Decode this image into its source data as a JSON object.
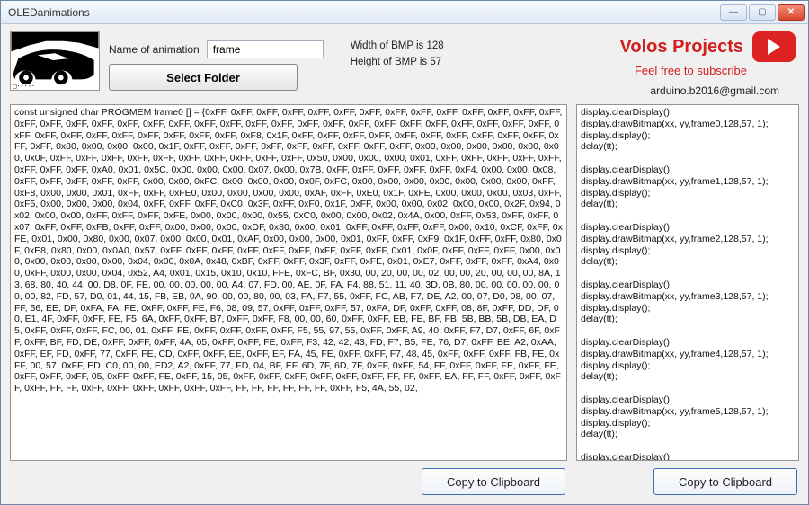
{
  "window": {
    "title": "OLEDanimations"
  },
  "controls": {
    "name_label": "Name of animation",
    "name_value": "frame",
    "select_folder": "Select Folder"
  },
  "bmp": {
    "width_label": "Width of BMP is 128",
    "height_label": "Height of BMP is 57"
  },
  "brand": {
    "title": "Volos Projects",
    "subtitle": "Feel free to subscribe",
    "email": "arduino.b2016@gmail.com"
  },
  "hex_output": "const unsigned char PROGMEM frame0 [] = {0xFF, 0xFF, 0xFF, 0xFF, 0xFF, 0xFF, 0xFF, 0xFF, 0xFF, 0xFF, 0xFF, 0xFF, 0xFF, 0xFF, 0xFF, 0xFF, 0xFF, 0xFF, 0xFF, 0xFF, 0xFF, 0xFF, 0xFF, 0xFF, 0xFF, 0xFF, 0xFF, 0xFF, 0xFF, 0xFF, 0xFF, 0xFF, 0xFF, 0xFF, 0xFF, 0xFF, 0xFF, 0xFF, 0xFF, 0xFF, 0xFF, 0xFF, 0xFF, 0xFF, 0xF8, 0x1F, 0xFF, 0xFF, 0xFF, 0xFF, 0xFF, 0xFF, 0xFF, 0xFF, 0xFF, 0xFF, 0xFF, 0xFF, 0x80, 0x00, 0x00, 0x00, 0x1F, 0xFF, 0xFF, 0xFF, 0xFF, 0xFF, 0xFF, 0xFF, 0xFF, 0xFF, 0x00, 0x00, 0x00, 0x00, 0x00, 0x00, 0x0F, 0xFF, 0xFF, 0xFF, 0xFF, 0xFF, 0xFF, 0xFF, 0xFF, 0xFF, 0xFF, 0x50, 0x00, 0x00, 0x00, 0x01, 0xFF, 0xFF, 0xFF, 0xFF, 0xFF, 0xFF, 0xFF, 0xFF, 0xA0, 0x01, 0x5C, 0x00, 0x00, 0x00, 0x07, 0x00, 0x7B, 0xFF, 0xFF, 0xFF, 0xFF, 0xFF, 0xF4, 0x00, 0x00, 0x08, 0xFF, 0xFF, 0xFF, 0xFF, 0xFF, 0x00, 0x00, 0xFC, 0x00, 0x00, 0x00, 0x0F, 0xFC, 0x00, 0x00, 0x00, 0x00, 0x00, 0x00, 0x00, 0xFF, 0xF8, 0x00, 0x00, 0x01, 0xFF, 0xFF, 0xFE0, 0x00, 0x00, 0x00, 0x00, 0xAF, 0xFF, 0xE0, 0x1F, 0xFE, 0x00, 0x00, 0x00, 0x03, 0xFF, 0xF5, 0x00, 0x00, 0x00, 0x04, 0xFF, 0xFF, 0xFF, 0xC0, 0x3F, 0xFF, 0xF0, 0x1F, 0xFF, 0x00, 0x00, 0x02, 0x00, 0x00, 0x2F, 0x94, 0x02, 0x00, 0x00, 0xFF, 0xFF, 0xFF, 0xFE, 0x00, 0x00, 0x00, 0x55, 0xC0, 0x00, 0x00, 0x02, 0x4A, 0x00, 0xFF, 0x53, 0xFF, 0xFF, 0x07, 0xFF, 0xFF, 0xFB, 0xFF, 0xFF, 0x00, 0x00, 0x00, 0xDF, 0x80, 0x00, 0x01, 0xFF, 0xFF, 0xFF, 0xFF, 0x00, 0x10, 0xCF, 0xFF, 0xFE, 0x01, 0x00, 0x80, 0x00, 0x07, 0x00, 0x00, 0x01, 0xAF, 0x00, 0x00, 0x00, 0x01, 0xFF, 0xFF, 0xF9, 0x1F, 0xFF, 0xFF, 0x80, 0x0F, 0xE8, 0x80, 0x00, 0x0A0, 0x57, 0xFF, 0xFF, 0xFF, 0xFF, 0xFF, 0xFF, 0xFF, 0xFF, 0xFF, 0x01, 0x0F, 0xFF, 0xFF, 0xFF, 0x00, 0x00, 0x00, 0x00, 0x00, 0x00, 0x04, 0x00, 0x0A, 0x48, 0xBF, 0xFF, 0xFF, 0x3F, 0xFF, 0xFE, 0x01, 0xE7, 0xFF, 0xFF, 0xFF, 0xA4, 0x00, 0xFF, 0x00, 0x00, 0x04, 0x52, A4, 0x01, 0x15, 0x10, 0x10, FFE, 0xFC, BF, 0x30, 00, 20, 00, 00, 02, 00, 00, 20, 00, 00, 00, 8A, 13, 68, 80, 40, 44, 00, D8, 0F, FE, 00, 00, 00, 00, 00, A4, 07, FD, 00, AE, 0F, FA, F4, 88, 51, 11, 40, 3D, 0B, 80, 00, 00, 00, 00, 00, 00, 00, 82, FD, 57, D0, 01, 44, 15, FB, EB, 0A, 90, 00, 00, 80, 00, 03, FA, F7, 55, 0xFF, FC, AB, F7, DE, A2, 00, 07, D0, 08, 00, 07, FF, 56, EE, DF, 0xFA, FA, FE, 0xFF, 0xFF, FE, F6, 08, 09, 57, 0xFF, 0xFF, 0xFF, 57, 0xFA, DF, 0xFF, 0xFF, 08, 8F, 0xFF, DD, DF, 00, E1, 4F, 0xFF, 0xFF, FE, F5, 6A, 0xFF, 0xFF, B7, 0xFF, 0xFF, F8, 00, 00, 60, 0xFF, 0xFF, EB, FE, BF, FB, 5B, BB, 5B, DB, EA, D5, 0xFF, 0xFF, 0xFF, FC, 00, 01, 0xFF, FE, 0xFF, 0xFF, 0xFF, 0xFF, F5, 55, 97, 55, 0xFF, 0xFF, A9, 40, 0xFF, F7, D7, 0xFF, 6F, 0xFF, 0xFF, BF, FD, DE, 0xFF, 0xFF, 0xFF, 4A, 05, 0xFF, 0xFF, FE, 0xFF, F3, 42, 42, 43, FD, F7, B5, FE, 76, D7, 0xFF, BE, A2, 0xAA, 0xFF, EF, FD, 0xFF, 77, 0xFF, FE, CD, 0xFF, 0xFF, EE, 0xFF, EF, FA, 45, FE, 0xFF, 0xFF, F7, 48, 45, 0xFF, 0xFF, 0xFF, FB, FE, 0xFF, 00, 57, 0xFF, ED, C0, 00, 00, ED2, A2, 0xFF, 77, FD, 04, BF, EF, 6D, 7F, 6D, 7F, 0xFF, 0xFF, 54, FF, 0xFF, 0xFF, FE, 0xFF, FE, 0xFF, 0xFF, 0xFF, 05, 0xFF, 0xFF, FE, 0xFF, 15, 05, 0xFF, 0xFF, 0xFF, 0xFF, 0xFF, 0xFF, FF, FF, 0xFF, EA, FF, FF, 0xFF, 0xFF, 0xFF, 0xFF, FF, FF, 0xFF, 0xFF, 0xFF, 0xFF, 0xFF, 0xFF, FF, FF, FF, FF, FF, FF, 0xFF, F5, 4A, 55, 02,",
  "code_output": "display.clearDisplay();\ndisplay.drawBitmap(xx, yy,frame0,128,57, 1);\ndisplay.display();\ndelay(tt);\n\ndisplay.clearDisplay();\ndisplay.drawBitmap(xx, yy,frame1,128,57, 1);\ndisplay.display();\ndelay(tt);\n\ndisplay.clearDisplay();\ndisplay.drawBitmap(xx, yy,frame2,128,57, 1);\ndisplay.display();\ndelay(tt);\n\ndisplay.clearDisplay();\ndisplay.drawBitmap(xx, yy,frame3,128,57, 1);\ndisplay.display();\ndelay(tt);\n\ndisplay.clearDisplay();\ndisplay.drawBitmap(xx, yy,frame4,128,57, 1);\ndisplay.display();\ndelay(tt);\n\ndisplay.clearDisplay();\ndisplay.drawBitmap(xx, yy,frame5,128,57, 1);\ndisplay.display();\ndelay(tt);\n\ndisplay.clearDisplay();",
  "buttons": {
    "copy": "Copy to Clipboard"
  }
}
